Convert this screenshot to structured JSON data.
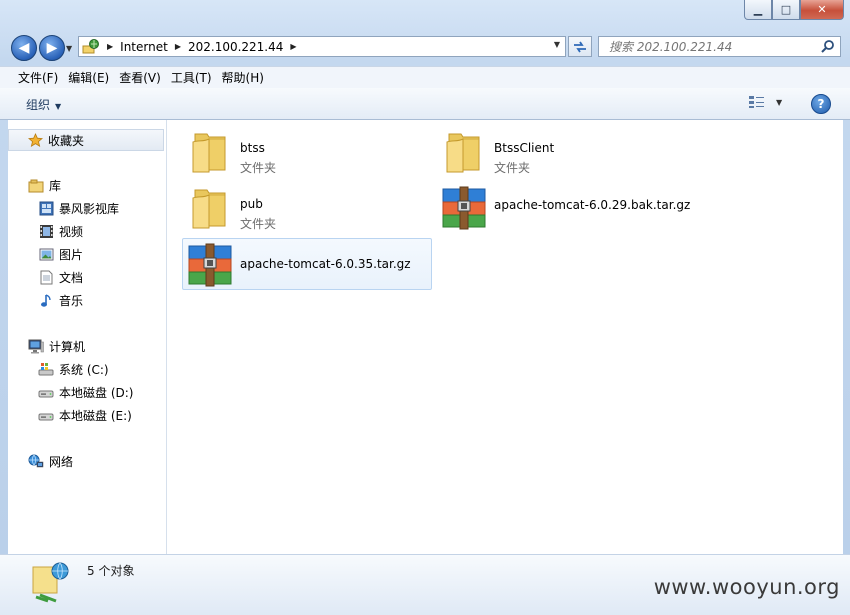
{
  "window": {
    "minimize": "▁",
    "maximize": "□",
    "close": "✕"
  },
  "nav": {
    "back": "◀",
    "forward": "▶",
    "history": "▼",
    "breadcrumb": [
      "Internet",
      "202.100.221.44"
    ],
    "search_placeholder": "搜索 202.100.221.44"
  },
  "menu": [
    "文件(F)",
    "编辑(E)",
    "查看(V)",
    "工具(T)",
    "帮助(H)"
  ],
  "toolbar": {
    "organize": "组织",
    "help": "?"
  },
  "sidebar": {
    "favorites": "收藏夹",
    "libraries": "库",
    "library_items": [
      "暴风影视库",
      "视频",
      "图片",
      "文档",
      "音乐"
    ],
    "computer": "计算机",
    "drives": [
      "系统 (C:)",
      "本地磁盘 (D:)",
      "本地磁盘 (E:)"
    ],
    "network": "网络"
  },
  "items": [
    {
      "name": "btss",
      "type": "文件夹",
      "icon": "folder-icon"
    },
    {
      "name": "BtssClient",
      "type": "文件夹",
      "icon": "folder-icon"
    },
    {
      "name": "pub",
      "type": "文件夹",
      "icon": "folder-icon"
    },
    {
      "name": "apache-tomcat-6.0.29.bak.tar.gz",
      "type": "",
      "icon": "archive-icon"
    },
    {
      "name": "apache-tomcat-6.0.35.tar.gz",
      "type": "",
      "icon": "archive-icon",
      "selected": true
    }
  ],
  "status": {
    "count": "5 个对象"
  },
  "watermark": "www.wooyun.org"
}
